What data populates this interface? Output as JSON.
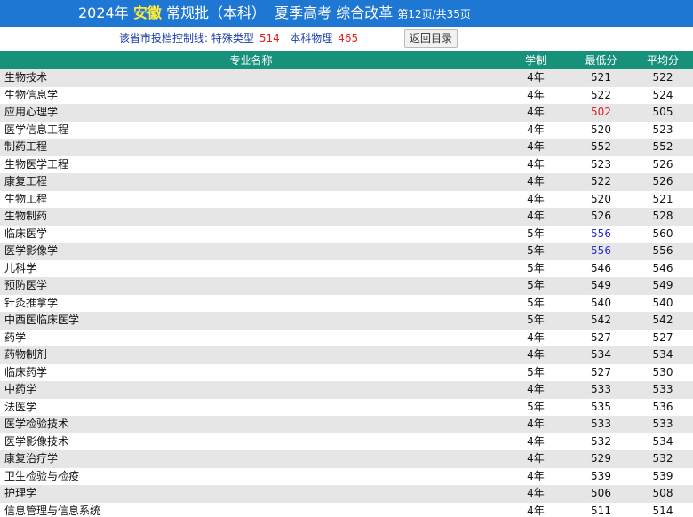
{
  "header": {
    "year": "2024年",
    "province": "安徽",
    "batch": "常规批（本科）",
    "exam": "夏季高考 综合改革",
    "pages": "第12页/共35页"
  },
  "info": {
    "label": "该省市投档控制线:",
    "special_label": "特殊类型_",
    "special_value": "514",
    "physics_label": "本科物理_",
    "physics_value": "465",
    "back_label": "返回目录"
  },
  "table": {
    "headers": [
      "专业名称",
      "学制",
      "最低分",
      "平均分"
    ],
    "rows": [
      {
        "name": "生物技术",
        "years": "4年",
        "min": "521",
        "avg": "522"
      },
      {
        "name": "生物信息学",
        "years": "4年",
        "min": "522",
        "avg": "524"
      },
      {
        "name": "应用心理学",
        "years": "4年",
        "min": "502",
        "avg": "505"
      },
      {
        "name": "医学信息工程",
        "years": "4年",
        "min": "520",
        "avg": "523"
      },
      {
        "name": "制药工程",
        "years": "4年",
        "min": "552",
        "avg": "552"
      },
      {
        "name": "生物医学工程",
        "years": "4年",
        "min": "523",
        "avg": "526"
      },
      {
        "name": "康复工程",
        "years": "4年",
        "min": "522",
        "avg": "526"
      },
      {
        "name": "生物工程",
        "years": "4年",
        "min": "520",
        "avg": "521"
      },
      {
        "name": "生物制药",
        "years": "4年",
        "min": "526",
        "avg": "528"
      },
      {
        "name": "临床医学",
        "years": "5年",
        "min": "556",
        "avg": "560"
      },
      {
        "name": "医学影像学",
        "years": "5年",
        "min": "556",
        "avg": "556"
      },
      {
        "name": "儿科学",
        "years": "5年",
        "min": "546",
        "avg": "546"
      },
      {
        "name": "预防医学",
        "years": "5年",
        "min": "549",
        "avg": "549"
      },
      {
        "name": "针灸推拿学",
        "years": "5年",
        "min": "540",
        "avg": "540"
      },
      {
        "name": "中西医临床医学",
        "years": "5年",
        "min": "542",
        "avg": "542"
      },
      {
        "name": "药学",
        "years": "4年",
        "min": "527",
        "avg": "527"
      },
      {
        "name": "药物制剂",
        "years": "4年",
        "min": "534",
        "avg": "534"
      },
      {
        "name": "临床药学",
        "years": "5年",
        "min": "527",
        "avg": "530"
      },
      {
        "name": "中药学",
        "years": "4年",
        "min": "533",
        "avg": "533"
      },
      {
        "name": "法医学",
        "years": "5年",
        "min": "535",
        "avg": "536"
      },
      {
        "name": "医学检验技术",
        "years": "4年",
        "min": "533",
        "avg": "533"
      },
      {
        "name": "医学影像技术",
        "years": "4年",
        "min": "532",
        "avg": "534"
      },
      {
        "name": "康复治疗学",
        "years": "4年",
        "min": "529",
        "avg": "532"
      },
      {
        "name": "卫生检验与检疫",
        "years": "4年",
        "min": "539",
        "avg": "539"
      },
      {
        "name": "护理学",
        "years": "4年",
        "min": "506",
        "avg": "508"
      },
      {
        "name": "信息管理与信息系统",
        "years": "4年",
        "min": "511",
        "avg": "514"
      }
    ],
    "highlights": {
      "red_min_rows": [
        2
      ],
      "blue_min_rows": [
        9,
        10
      ]
    }
  },
  "colors": {
    "title_bg": "#1e77d2",
    "header_bg": "#17917a",
    "province": "#ffeb3b",
    "red": "#e02020",
    "blue": "#2a2ad0"
  }
}
